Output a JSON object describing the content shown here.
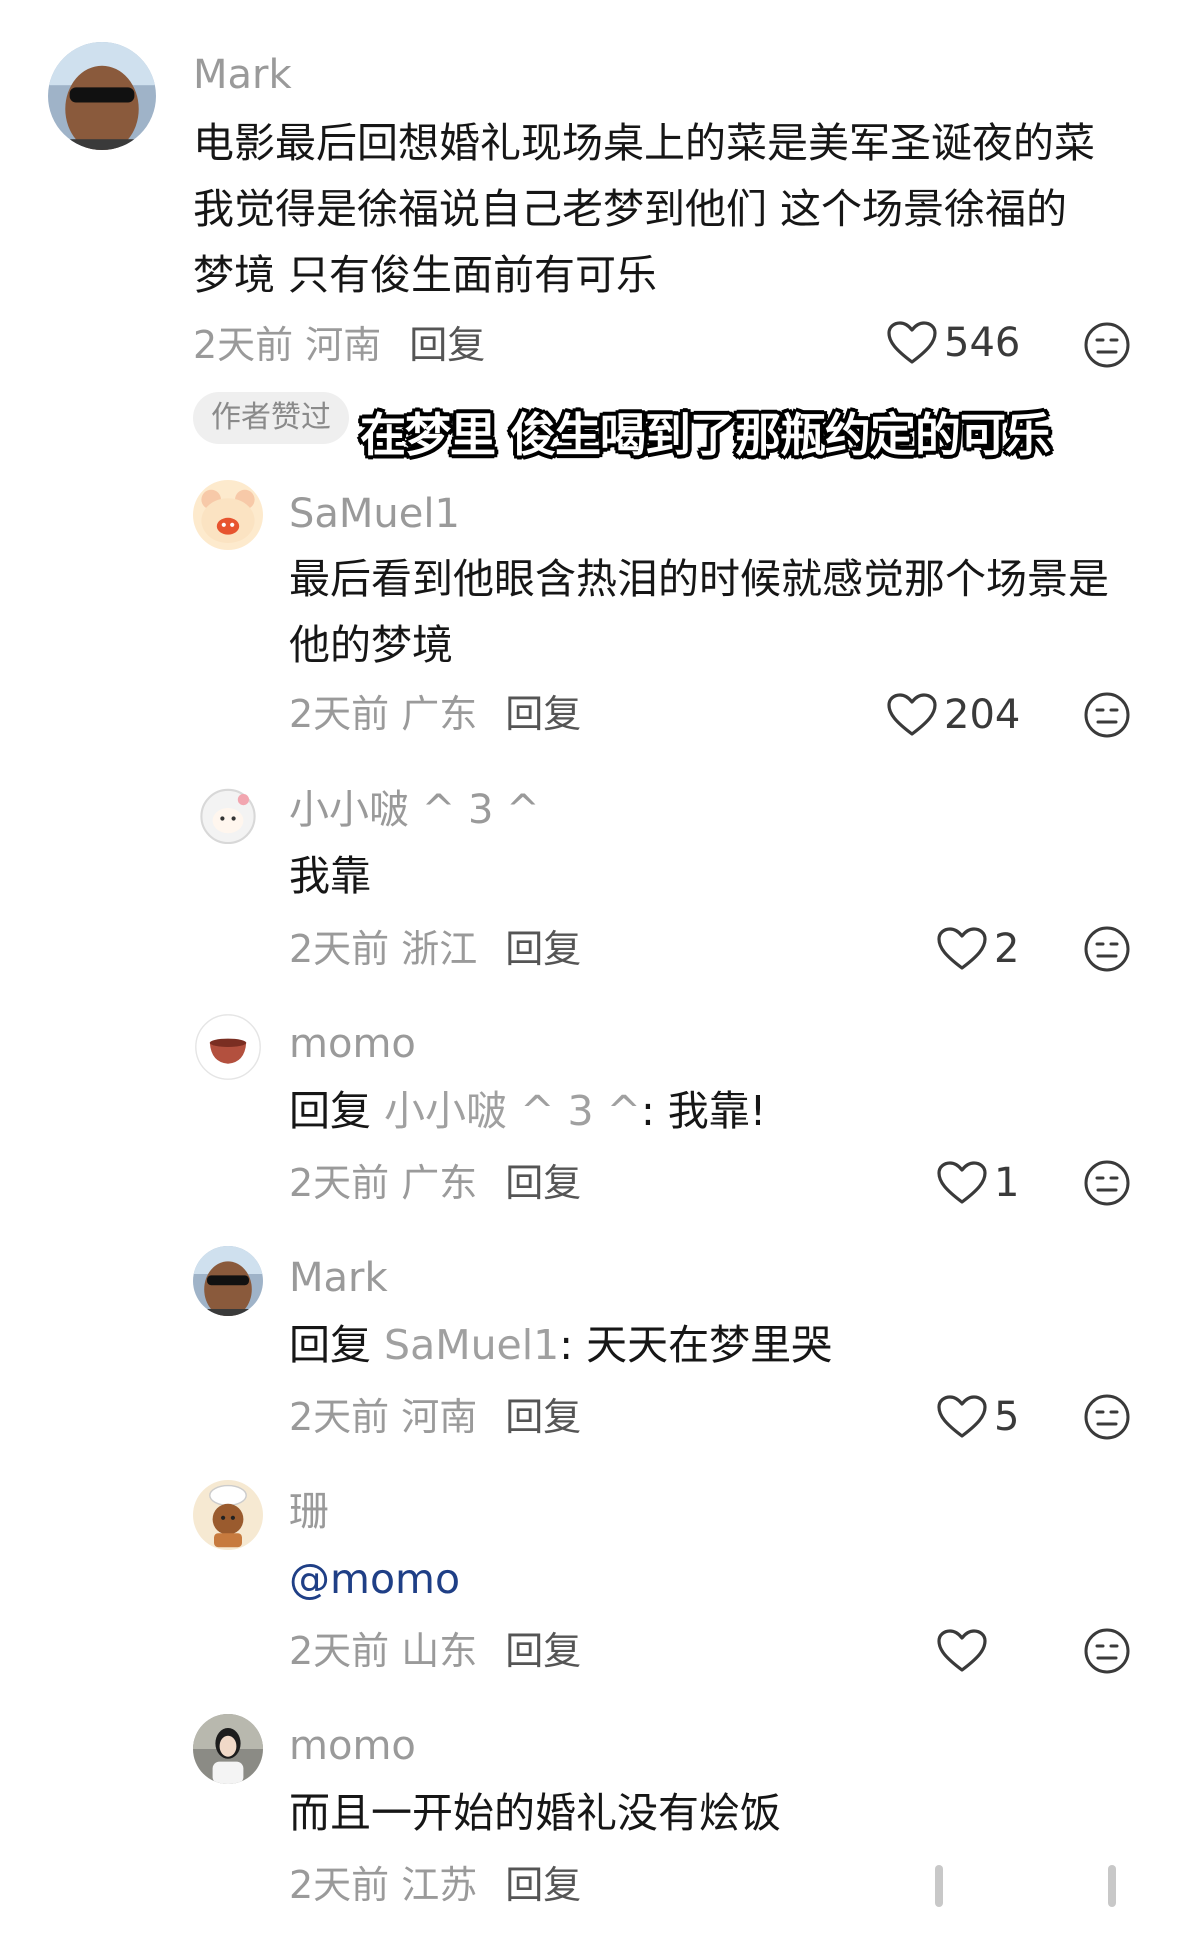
{
  "comments": [
    {
      "user": "Mark",
      "lines": [
        "电影最后回想婚礼现场桌上的菜是美军圣诞夜的菜",
        "我觉得是徐福说自己老梦到他们   这个场景徐福的",
        "梦境   只有俊生面前有可乐"
      ],
      "time": "2天前",
      "region": "河南",
      "reply": "回复",
      "likes": "546"
    },
    {
      "user": "SaMuel1",
      "lines": [
        "最后看到他眼含热泪的时候就感觉那个场景是",
        "他的梦境"
      ],
      "time": "2天前",
      "region": "广东",
      "reply": "回复",
      "likes": "204"
    },
    {
      "user": "小小啵 ^ 3 ^",
      "lines": [
        "我靠"
      ],
      "time": "2天前",
      "region": "浙江",
      "reply": "回复",
      "likes": "2"
    },
    {
      "user": "momo",
      "reply_prefix": "回复",
      "reply_to": "小小啵 ^ 3 ^",
      "reply_text": ": 我靠!",
      "time": "2天前",
      "region": "广东",
      "reply": "回复",
      "likes": "1"
    },
    {
      "user": "Mark",
      "reply_prefix": "回复",
      "reply_to": "SaMuel1",
      "reply_text": ": 天天在梦里哭",
      "time": "2天前",
      "region": "河南",
      "reply": "回复",
      "likes": "5"
    },
    {
      "user": "珊",
      "mention": "@momo",
      "time": "2天前",
      "region": "山东",
      "reply": "回复",
      "likes": ""
    },
    {
      "user": "momo",
      "lines": [
        "而且一开始的婚礼没有烩饭"
      ],
      "time": "2天前",
      "region": "江苏",
      "reply": "回复"
    }
  ],
  "author_badge": "作者赞过",
  "overlay_caption": "在梦里 俊生喝到了那瓶约定的可乐",
  "icons": {
    "like": "heart-outline-icon",
    "dislike": "meh-face-icon"
  },
  "colors": {
    "meta": "#9a9a9a",
    "mention": "#1f3f86",
    "badge_bg": "#efefef"
  }
}
